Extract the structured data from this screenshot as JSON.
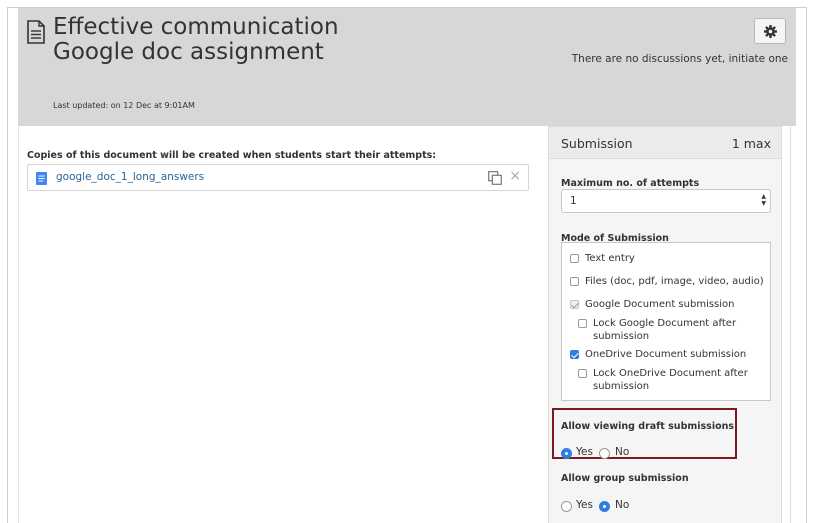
{
  "header": {
    "title": "Effective communication Google doc assignment",
    "last_updated": "Last updated: on 12 Dec at 9:01AM",
    "discussions": "There are no discussions yet, initiate one",
    "settings_icon": "gear-icon"
  },
  "copies": {
    "label": "Copies of this document will be created when students start their attempts:",
    "file_name": "google_doc_1_long_answers",
    "close_glyph": "×"
  },
  "submission": {
    "title": "Submission",
    "max": "1 max",
    "attempts_label": "Maximum no. of attempts",
    "attempts_value": "1",
    "mode_label": "Mode of Submission",
    "modes": [
      {
        "label": "Text entry",
        "checked": false
      },
      {
        "label": "Files (doc, pdf, image, video, audio)",
        "checked": false
      },
      {
        "label": "Google Document submission",
        "checked": true
      },
      {
        "label": "Lock Google Document after submission",
        "checked": false
      },
      {
        "label": "OneDrive Document submission",
        "checked": true
      },
      {
        "label": "Lock OneDrive Document after submission",
        "checked": false
      }
    ],
    "draft_label": "Allow viewing draft submissions",
    "draft_yes": "Yes",
    "draft_no": "No",
    "draft_value": "Yes",
    "group_label": "Allow group submission",
    "group_yes": "Yes",
    "group_no": "No",
    "group_value": "No"
  },
  "colors": {
    "header_bg": "#d7d7d7",
    "accent": "#2f7de1",
    "highlight_border": "#7b1a1f",
    "link": "#2a6496"
  }
}
